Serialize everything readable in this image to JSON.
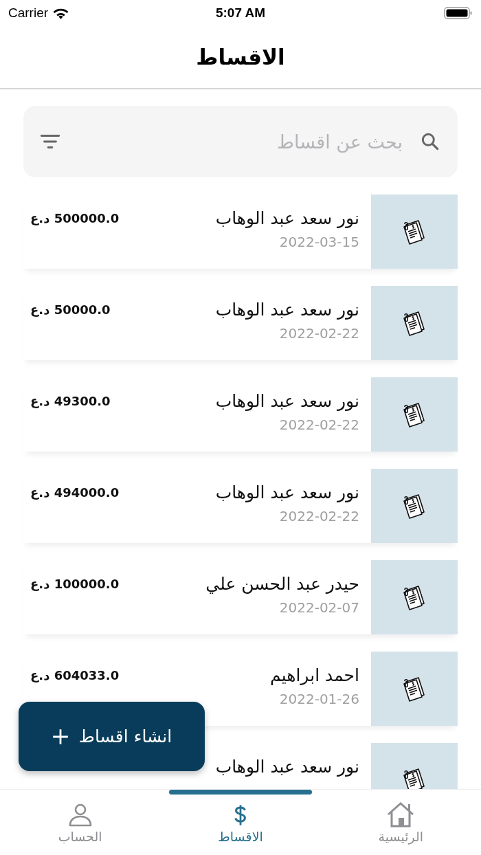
{
  "status_bar": {
    "carrier": "Carrier",
    "time": "5:07 AM"
  },
  "header": {
    "title": "الاقساط"
  },
  "search": {
    "placeholder": "بحث عن اقساط"
  },
  "installments": [
    {
      "name": "نور سعد عبد الوهاب",
      "date": "2022-03-15",
      "amount": "500000.0 د.ع"
    },
    {
      "name": "نور سعد عبد الوهاب",
      "date": "2022-02-22",
      "amount": "50000.0 د.ع"
    },
    {
      "name": "نور سعد عبد الوهاب",
      "date": "2022-02-22",
      "amount": "49300.0 د.ع"
    },
    {
      "name": "نور سعد عبد الوهاب",
      "date": "2022-02-22",
      "amount": "494000.0 د.ع"
    },
    {
      "name": "حيدر عبد الحسن علي",
      "date": "2022-02-07",
      "amount": "100000.0 د.ع"
    },
    {
      "name": "احمد ابراهيم",
      "date": "2022-01-26",
      "amount": "604033.0 د.ع"
    },
    {
      "name": "نور سعد عبد الوهاب"
    }
  ],
  "fab": {
    "label": "انشاء اقساط"
  },
  "tabs": [
    {
      "kind": "home",
      "label": "الرئيسية",
      "selected": false
    },
    {
      "kind": "money",
      "label": "الاقساط",
      "selected": true
    },
    {
      "kind": "account",
      "label": "الحساب",
      "selected": false
    }
  ]
}
